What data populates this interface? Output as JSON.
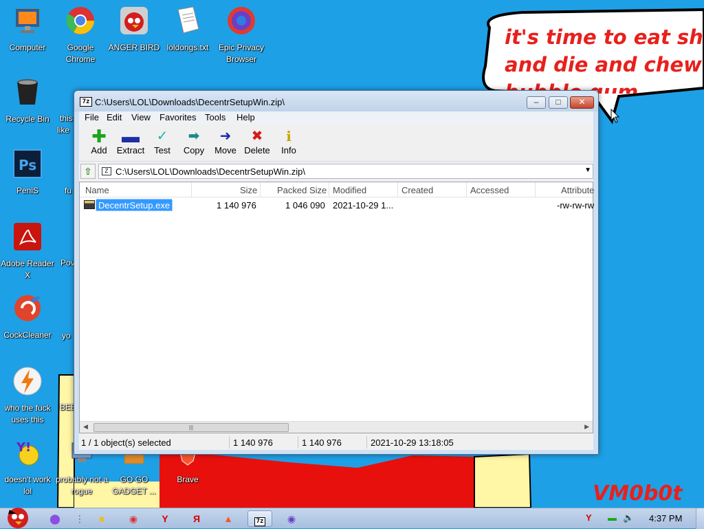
{
  "desktop": {
    "speech_bubble_lines": [
      "it's time to eat shit",
      "and die and chew",
      "bubble gum"
    ],
    "signature": "VM0b0t",
    "icons": [
      {
        "label": "Computer"
      },
      {
        "label": "Google Chrome"
      },
      {
        "label": "ANGER BIRD"
      },
      {
        "label": "loldongs.txt"
      },
      {
        "label": "Epic Privacy Browser"
      },
      {
        "label": "Recycle Bin"
      },
      {
        "label": "PeniS"
      },
      {
        "label": "Adobe Reader X"
      },
      {
        "label": "CockCleaner"
      },
      {
        "label": "who the fuck uses this"
      },
      {
        "label": "doesn't work lol"
      },
      {
        "label": "probably not a rogue"
      },
      {
        "label": "GO GO GADGET ..."
      },
      {
        "label": "Brave"
      }
    ],
    "partial_labels": [
      "this",
      "like",
      "fu",
      "Pov",
      "yo",
      "BEE"
    ]
  },
  "window": {
    "title": "C:\\Users\\LOL\\Downloads\\DecentrSetupWin.zip\\",
    "app_icon_text": "7z",
    "menu": [
      "File",
      "Edit",
      "View",
      "Favorites",
      "Tools",
      "Help"
    ],
    "toolbar": [
      {
        "label": "Add",
        "icon": "plus-icon",
        "color": "#1fa31f"
      },
      {
        "label": "Extract",
        "icon": "minus-icon",
        "color": "#1c2fa8"
      },
      {
        "label": "Test",
        "icon": "check-icon",
        "color": "#16b8b0"
      },
      {
        "label": "Copy",
        "icon": "arrow-right-double-icon",
        "color": "#1a8a8a"
      },
      {
        "label": "Move",
        "icon": "arrow-right-icon",
        "color": "#1c2fa8"
      },
      {
        "label": "Delete",
        "icon": "x-icon",
        "color": "#d81a1a"
      },
      {
        "label": "Info",
        "icon": "info-icon",
        "color": "#c8a400"
      }
    ],
    "address": "C:\\Users\\LOL\\Downloads\\DecentrSetupWin.zip\\",
    "columns": [
      "Name",
      "Size",
      "Packed Size",
      "Modified",
      "Created",
      "Accessed",
      "Attribute"
    ],
    "rows": [
      {
        "name": "DecentrSetup.exe",
        "size": "1 140 976",
        "packed_size": "1 046 090",
        "modified": "2021-10-29 1...",
        "created": "",
        "accessed": "",
        "attributes": "-rw-rw-rw"
      }
    ],
    "status": {
      "selection": "1 / 1 object(s) selected",
      "size": "1 140 976",
      "packed": "1 140 976",
      "modified": "2021-10-29 13:18:05"
    }
  },
  "taskbar": {
    "clock": "4:37 PM"
  }
}
